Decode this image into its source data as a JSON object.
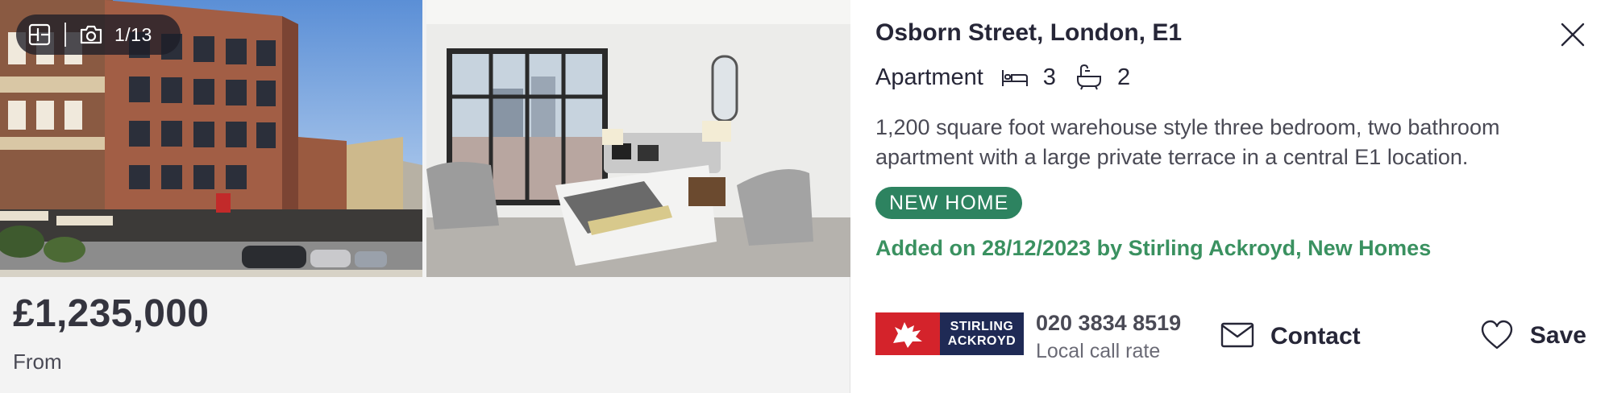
{
  "gallery": {
    "counter": "1/13",
    "floorplan_icon": "floorplan-icon",
    "camera_icon": "camera-icon"
  },
  "listing": {
    "price": "£1,235,000",
    "price_qualifier": "From",
    "address": "Osborn Street, London, E1",
    "property_type": "Apartment",
    "bedrooms": "3",
    "bathrooms": "2",
    "summary": "1,200 square foot warehouse style three bedroom, two bathroom apartment with a large private terrace in a central E1 location.",
    "badge": "NEW HOME",
    "added": "Added on 28/12/2023 by Stirling Ackroyd, New Homes"
  },
  "agent": {
    "logo_line1": "STIRLING",
    "logo_line2": "ACKROYD",
    "phone": "020 3834 8519",
    "phone_note": "Local call rate"
  },
  "actions": {
    "contact_label": "Contact",
    "save_label": "Save"
  },
  "colors": {
    "badge_bg": "#2d8360",
    "added_text": "#3a9160",
    "agent_navy": "#1f2a55",
    "agent_red": "#d4232b"
  }
}
